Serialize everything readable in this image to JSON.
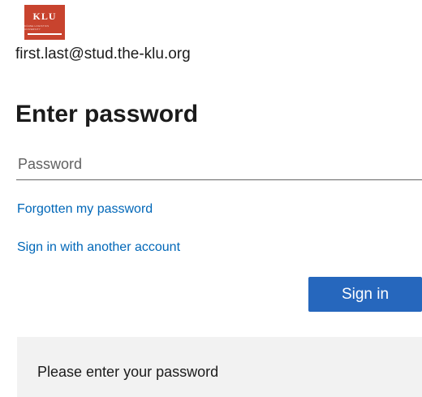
{
  "logo": {
    "text": "KLU",
    "subtext": "KÜHNE LOGISTICS UNIVERSITY"
  },
  "account": {
    "email": "first.last@stud.the-klu.org"
  },
  "title": "Enter password",
  "password": {
    "placeholder": "Password",
    "value": ""
  },
  "links": {
    "forgot": "Forgotten my password",
    "other_account": "Sign in with another account"
  },
  "buttons": {
    "sign_in": "Sign in"
  },
  "message": {
    "text": "Please enter your password"
  },
  "colors": {
    "brand": "#c8432e",
    "link": "#0067b8",
    "button": "#2667bd",
    "message_bg": "#f2f2f2"
  }
}
